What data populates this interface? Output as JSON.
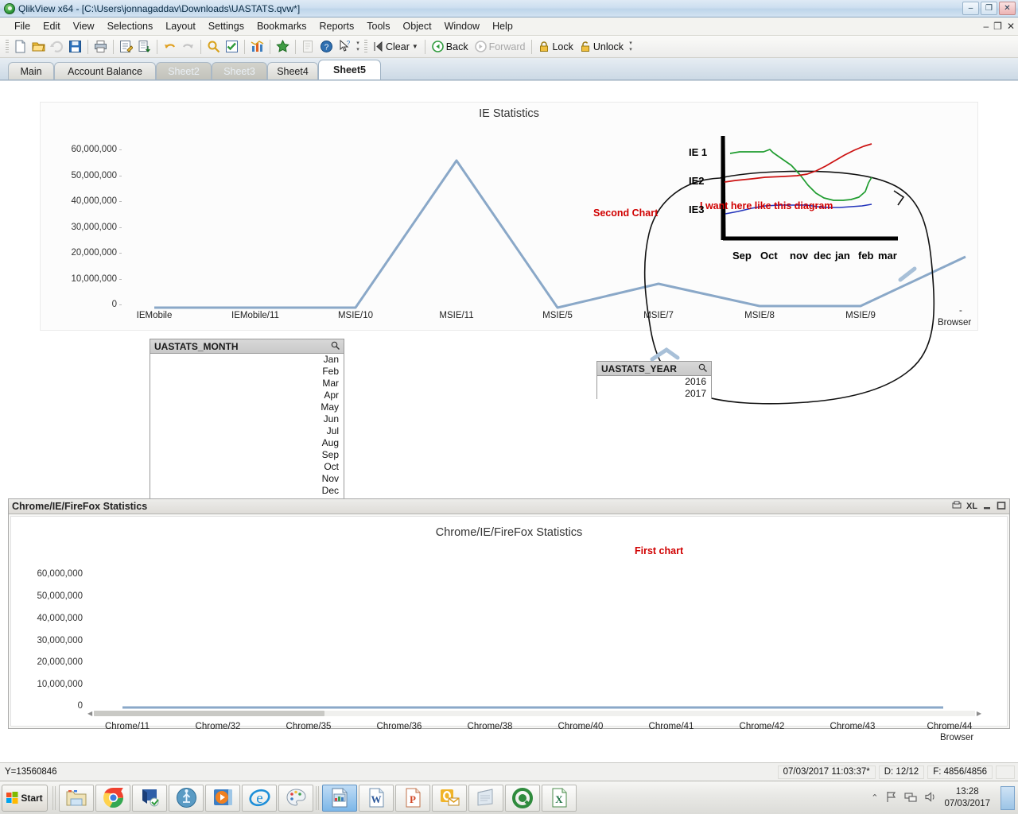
{
  "window": {
    "title": "QlikView x64 - [C:\\Users\\jonnagaddav\\Downloads\\UASTATS.qvw*]",
    "minimize": "–",
    "restore": "❐",
    "close": "✕",
    "inner_minimize": "–",
    "inner_restore": "❐",
    "inner_close": "✕"
  },
  "menu": {
    "items": [
      {
        "label": "File"
      },
      {
        "label": "Edit"
      },
      {
        "label": "View"
      },
      {
        "label": "Selections"
      },
      {
        "label": "Layout"
      },
      {
        "label": "Settings"
      },
      {
        "label": "Bookmarks"
      },
      {
        "label": "Reports"
      },
      {
        "label": "Tools"
      },
      {
        "label": "Object"
      },
      {
        "label": "Window"
      },
      {
        "label": "Help"
      }
    ]
  },
  "toolbar": {
    "icons": [
      {
        "name": "new-document-icon"
      },
      {
        "name": "open-folder-icon"
      },
      {
        "name": "reload-icon"
      },
      {
        "name": "save-icon"
      },
      {
        "name": "print-icon"
      },
      {
        "name": "edit-script-icon"
      },
      {
        "name": "table-viewer-icon"
      },
      {
        "name": "undo-icon"
      },
      {
        "name": "redo-icon"
      },
      {
        "name": "search-icon"
      },
      {
        "name": "current-selections-icon"
      },
      {
        "name": "chart-icon"
      },
      {
        "name": "favorite-icon"
      },
      {
        "name": "notes-icon"
      },
      {
        "name": "help-icon"
      },
      {
        "name": "context-help-icon"
      }
    ],
    "clear_label": "Clear",
    "back_label": "Back",
    "forward_label": "Forward",
    "lock_label": "Lock",
    "unlock_label": "Unlock"
  },
  "tabs": [
    {
      "label": "Main",
      "state": "normal"
    },
    {
      "label": "Account Balance",
      "state": "normal"
    },
    {
      "label": "Sheet2",
      "state": "dim"
    },
    {
      "label": "Sheet3",
      "state": "dim"
    },
    {
      "label": "Sheet4",
      "state": "normal"
    },
    {
      "label": "Sheet5",
      "state": "active"
    }
  ],
  "top_chart": {
    "title": "IE Statistics",
    "axis_name": "Browser",
    "axis_dash": "-"
  },
  "bottom_panel": {
    "title": "Chrome/IE/FireFox  Statistics",
    "chart_title": "Chrome/IE/FireFox Statistics",
    "axis_name": "Browser",
    "controls": {
      "export_icon": "export-icon",
      "xl_label": "XL",
      "minimize_icon": "minimize-icon",
      "maximize_icon": "maximize-icon"
    },
    "scroll_left_arrow": "◀",
    "scroll_right_arrow": "▶"
  },
  "month_listbox": {
    "title": "UASTATS_MONTH",
    "search_icon": "magnifier-icon",
    "items": [
      "Jan",
      "Feb",
      "Mar",
      "Apr",
      "May",
      "Jun",
      "Jul",
      "Aug",
      "Sep",
      "Oct",
      "Nov",
      "Dec"
    ]
  },
  "year_listbox": {
    "title": "UASTATS_YEAR",
    "search_icon": "magnifier-icon",
    "items": [
      "2016",
      "2017"
    ]
  },
  "annotations": {
    "second_chart": "Second Chart",
    "first_chart": "First chart",
    "sketch_title": "I want here like this  diagram",
    "series_labels": [
      "IE 1",
      "IE2",
      "IE3"
    ],
    "months": [
      "Sep",
      "Oct",
      "nov",
      "dec",
      "jan",
      "feb",
      "mar"
    ],
    "color_red": "#d00000",
    "sketch_green": "#1f9c2f",
    "sketch_red": "#cc1111",
    "sketch_blue": "#2233bb"
  },
  "statusbar": {
    "left": "Y=13560846",
    "timestamp": "07/03/2017 11:03:37*",
    "documents": "D: 12/12",
    "fields": "F: 4856/4856"
  },
  "taskbar": {
    "start_label": "Start",
    "apps": [
      {
        "name": "file-explorer-icon",
        "selected": false
      },
      {
        "name": "google-chrome-icon",
        "selected": false
      },
      {
        "name": "remote-desktop-icon",
        "selected": false
      },
      {
        "name": "database-icon",
        "selected": false
      },
      {
        "name": "media-player-icon",
        "selected": false
      },
      {
        "name": "internet-explorer-icon",
        "selected": false
      },
      {
        "name": "paint-icon",
        "selected": false
      },
      {
        "name": "qlikview-document-icon",
        "selected": true
      },
      {
        "name": "ms-word-icon",
        "selected": false
      },
      {
        "name": "ms-powerpoint-icon",
        "selected": false
      },
      {
        "name": "ms-outlook-icon",
        "selected": false
      },
      {
        "name": "notepad-icon",
        "selected": false
      },
      {
        "name": "qlikview-icon",
        "selected": false
      },
      {
        "name": "ms-excel-icon",
        "selected": false
      }
    ],
    "tray": {
      "expand_icon": "chevron-up-icon",
      "flag_icon": "action-center-icon",
      "network_icon": "network-icon",
      "volume_icon": "volume-icon",
      "time": "13:28",
      "date": "07/03/2017",
      "show_desktop": "show-desktop-icon"
    }
  },
  "chart_data": [
    {
      "type": "line",
      "title": "IE Statistics",
      "xlabel": "Browser",
      "ylabel": "",
      "categories": [
        "IEMobile",
        "IEMobile/11",
        "MSIE/10",
        "MSIE/11",
        "MSIE/5",
        "MSIE/7",
        "MSIE/8",
        "MSIE/9"
      ],
      "values": [
        0,
        0,
        0,
        54000000,
        0,
        8500000,
        4000000,
        4000000
      ],
      "ytick_labels": [
        "60,000,000",
        "50,000,000",
        "40,000,000",
        "30,000,000",
        "20,000,000",
        "10,000,000",
        "0"
      ],
      "ylim": [
        0,
        63000000
      ],
      "grid": false,
      "legend": "none",
      "series_color": "#8aa8c8"
    },
    {
      "type": "line",
      "title": "Chrome/IE/FireFox Statistics",
      "xlabel": "Browser",
      "ylabel": "",
      "categories": [
        "Chrome/11",
        "Chrome/32",
        "Chrome/35",
        "Chrome/36",
        "Chrome/38",
        "Chrome/40",
        "Chrome/41",
        "Chrome/42",
        "Chrome/43",
        "Chrome/44"
      ],
      "values": [
        0,
        0,
        0,
        0,
        0,
        0,
        0,
        0,
        0,
        0
      ],
      "ytick_labels": [
        "60,000,000",
        "50,000,000",
        "40,000,000",
        "30,000,000",
        "20,000,000",
        "10,000,000",
        "0"
      ],
      "ylim": [
        0,
        63000000
      ],
      "grid": false,
      "legend": "none",
      "series_color": "#8aa8c8"
    },
    {
      "type": "line",
      "title": "I want here like this  diagram",
      "is_hand_sketch": true,
      "xlabel": "",
      "ylabel": "",
      "categories": [
        "Sep",
        "Oct",
        "nov",
        "dec",
        "jan",
        "feb",
        "mar"
      ],
      "series": [
        {
          "name": "IE 1",
          "color": "#1f9c2f",
          "values": [
            80,
            82,
            72,
            48,
            30,
            28,
            40
          ]
        },
        {
          "name": "IE2",
          "color": "#cc1111",
          "values": [
            46,
            49,
            52,
            58,
            72,
            86,
            92
          ]
        },
        {
          "name": "IE3",
          "color": "#2233bb",
          "values": [
            20,
            24,
            28,
            28,
            26,
            26,
            30
          ]
        }
      ],
      "legend": "left-labels"
    }
  ]
}
